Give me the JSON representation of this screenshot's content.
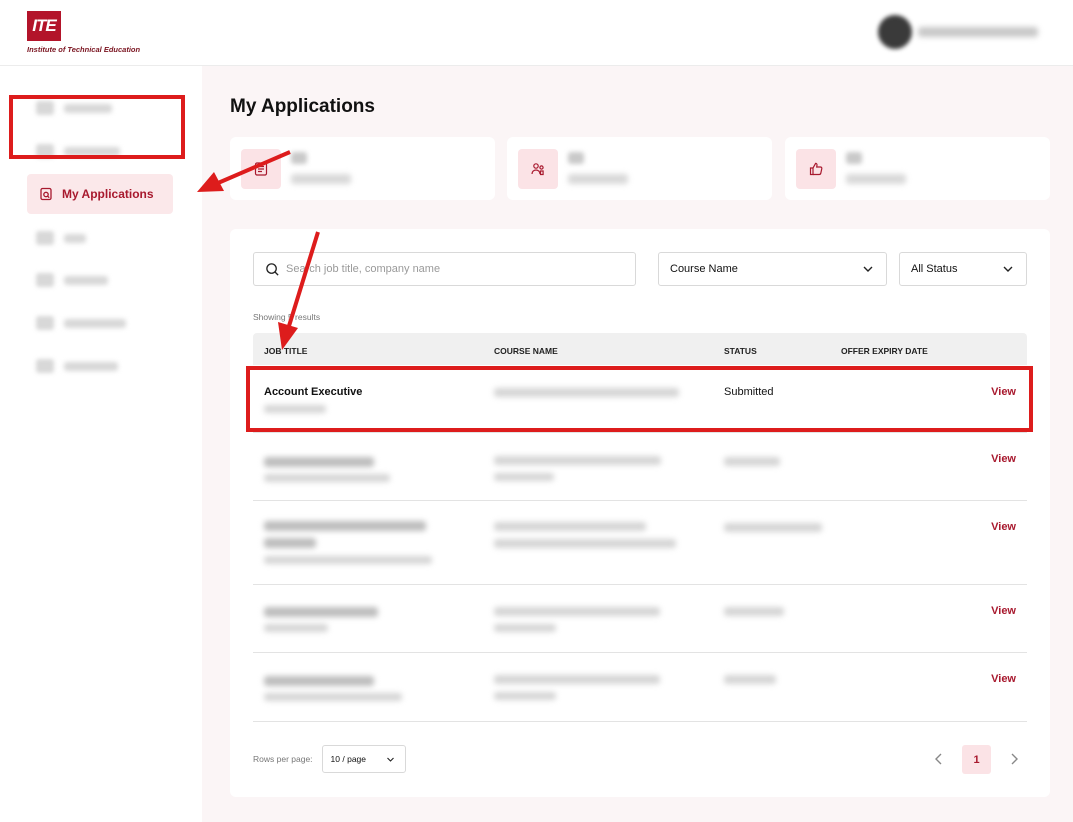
{
  "header": {
    "logo_mark": "ITE",
    "logo_text": "Institute of Technical Education"
  },
  "sidebar": {
    "active_label": "My Applications"
  },
  "main": {
    "title": "My Applications"
  },
  "filters": {
    "search_placeholder": "Search job title, company name",
    "course_select": "Course Name",
    "status_select": "All Status"
  },
  "table": {
    "results_text": "Showing 5 results",
    "columns": [
      "JOB TITLE",
      "COURSE NAME",
      "STATUS",
      "OFFER EXPIRY DATE"
    ],
    "rows": [
      {
        "title": "Account Executive",
        "status": "Submitted",
        "action": "View"
      },
      {
        "title": "",
        "status": "",
        "action": "View"
      },
      {
        "title": "",
        "status": "",
        "action": "View"
      },
      {
        "title": "",
        "status": "",
        "action": "View"
      },
      {
        "title": "",
        "status": "",
        "action": "View"
      }
    ]
  },
  "pagination": {
    "rows_per_page_label": "Rows per page:",
    "page_size": "10 / page",
    "current_page": "1"
  },
  "colors": {
    "brand": "#a8192e",
    "highlight": "#dd1c1c"
  }
}
